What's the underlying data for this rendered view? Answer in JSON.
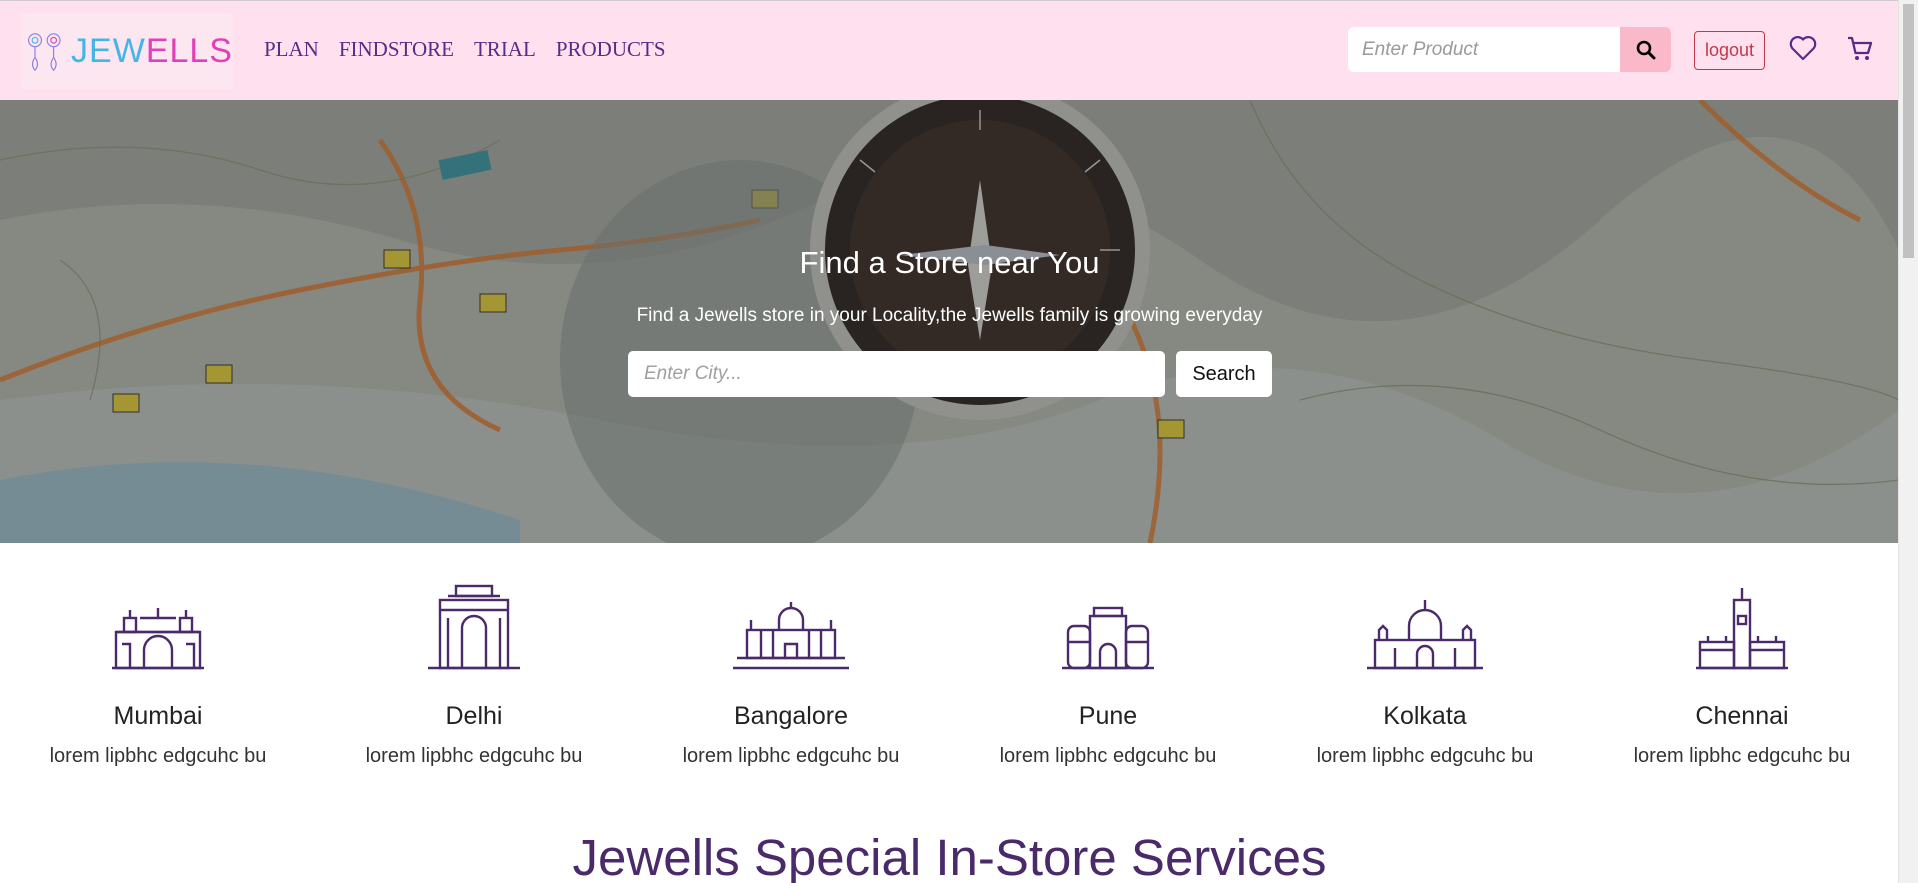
{
  "brand": {
    "logo_text_a": "JEW",
    "logo_text_b": "ELLS",
    "accent": "#5b2a86",
    "navbar_bg": "#ffe0ef"
  },
  "nav": {
    "items": [
      {
        "label": "PLAN"
      },
      {
        "label": "FINDSTORE"
      },
      {
        "label": "TRIAL"
      },
      {
        "label": "PRODUCTS"
      }
    ]
  },
  "header": {
    "search_placeholder": "Enter Product",
    "logout_label": "logout",
    "icons": [
      "search-icon",
      "heart-icon",
      "cart-icon"
    ]
  },
  "hero": {
    "title": "Find a Store near You",
    "subtitle": "Find a Jewells store in your Locality,the Jewells family is growing everyday",
    "city_placeholder": "Enter City...",
    "search_label": "Search"
  },
  "cities": [
    {
      "name": "Mumbai",
      "desc": "lorem lipbhc edgcuhc bu",
      "icon": "gateway-of-india-icon"
    },
    {
      "name": "Delhi",
      "desc": "lorem lipbhc edgcuhc bu",
      "icon": "india-gate-icon"
    },
    {
      "name": "Bangalore",
      "desc": "lorem lipbhc edgcuhc bu",
      "icon": "vidhana-soudha-icon"
    },
    {
      "name": "Pune",
      "desc": "lorem lipbhc edgcuhc bu",
      "icon": "shaniwar-wada-icon"
    },
    {
      "name": "Kolkata",
      "desc": "lorem lipbhc edgcuhc bu",
      "icon": "victoria-memorial-icon"
    },
    {
      "name": "Chennai",
      "desc": "lorem lipbhc edgcuhc bu",
      "icon": "chennai-central-icon"
    }
  ],
  "services": {
    "title": "Jewells Special In-Store Services"
  }
}
